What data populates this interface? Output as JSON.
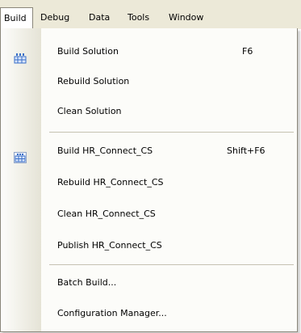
{
  "menubar": {
    "items": [
      "Build",
      "Debug",
      "Data",
      "Tools",
      "Window"
    ]
  },
  "build_menu": {
    "groups": [
      {
        "items": [
          {
            "label": "Build Solution",
            "shortcut": "F6",
            "icon": "build-solution-icon"
          },
          {
            "label": "Rebuild Solution"
          },
          {
            "label": "Clean Solution"
          }
        ]
      },
      {
        "items": [
          {
            "label": "Build HR_Connect_CS",
            "shortcut": "Shift+F6",
            "icon": "build-project-icon"
          },
          {
            "label": "Rebuild HR_Connect_CS"
          },
          {
            "label": "Clean HR_Connect_CS"
          },
          {
            "label": "Publish HR_Connect_CS"
          }
        ]
      },
      {
        "items": [
          {
            "label": "Batch Build..."
          },
          {
            "label": "Configuration Manager..."
          }
        ]
      }
    ]
  },
  "colors": {
    "menubar_bg": "#ece9d8",
    "menu_bg": "#fcfcf9",
    "border": "#8a867a",
    "icon_blue": "#3a6fc8"
  }
}
